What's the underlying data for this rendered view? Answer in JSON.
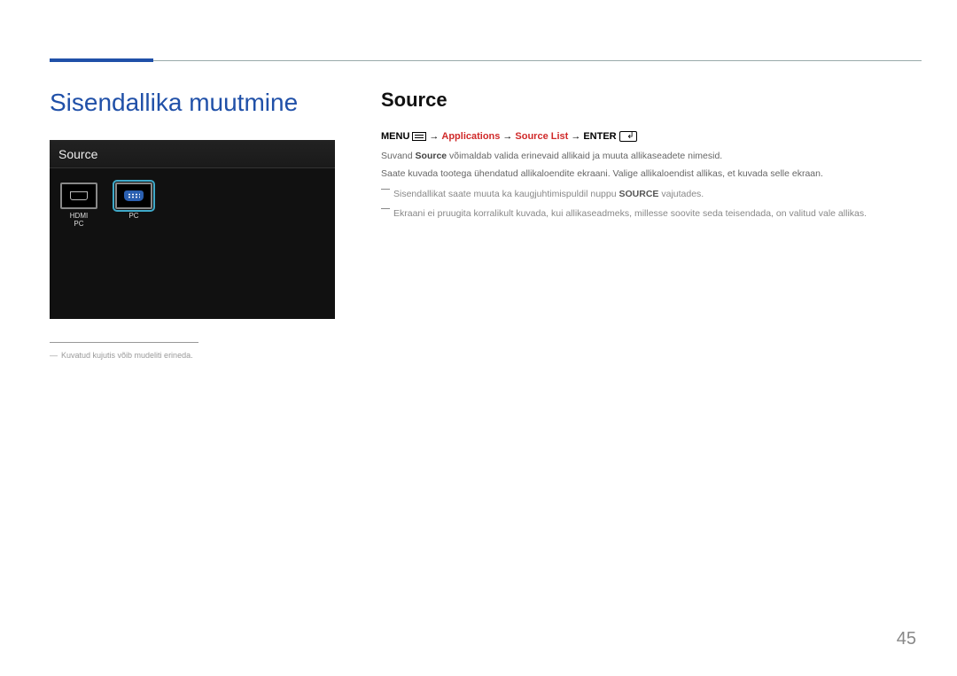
{
  "page_number": "45",
  "chapter_title": "Sisendallika muutmine",
  "section_title": "Source",
  "nav_path": {
    "menu": "MENU",
    "applications": "Applications",
    "source_list": "Source List",
    "enter": "ENTER"
  },
  "para1_pre": "Suvand ",
  "para1_strong": "Source",
  "para1_post": " võimaldab valida erinevaid allikaid ja muuta allikaseadete nimesid.",
  "para2": "Saate kuvada tootega ühendatud allikaloendite ekraani. Valige allikaloendist allikas, et kuvada selle ekraan.",
  "note1_pre": "Sisendallikat saate muuta ka kaugjuhtimispuldil nuppu ",
  "note1_strong": "SOURCE",
  "note1_post": " vajutades.",
  "note2": "Ekraani ei pruugita korralikult kuvada, kui allikaseadmeks, millesse soovite seda teisendada, on valitud vale allikas.",
  "screenshot": {
    "title": "Source",
    "item1_line1": "HDMI",
    "item1_line2": "PC",
    "item2": "PC"
  },
  "footnote_dash": "―",
  "footnote_text": "Kuvatud kujutis võib mudeliti erineda."
}
